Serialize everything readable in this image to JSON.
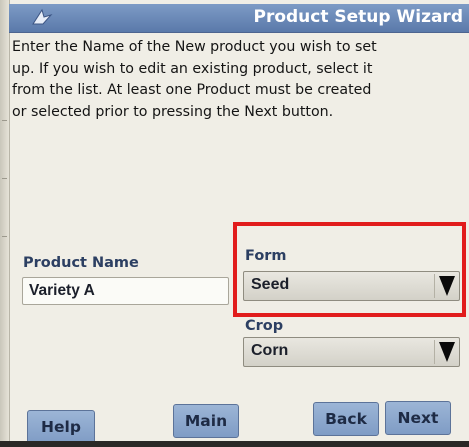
{
  "window": {
    "title": "Product Setup Wizard"
  },
  "instructions": {
    "lines": [
      "Enter the Name of the New product you wish to set",
      "up. If you wish to edit an existing product, select it",
      "from the list. At least one Product must be created",
      "or selected prior to pressing the Next button."
    ]
  },
  "product_name": {
    "label": "Product Name",
    "value": "Variety A"
  },
  "form": {
    "label": "Form",
    "selected": "Seed"
  },
  "crop": {
    "label": "Crop",
    "selected": "Corn"
  },
  "buttons": {
    "help": "Help",
    "main": "Main",
    "back": "Back",
    "next": "Next"
  },
  "icons": {
    "title": "wizard-arrow-icon",
    "dropdown": "dropdown-arrow-icon"
  },
  "colors": {
    "title_bar": "#6b89b8",
    "button": "#8ea8cd",
    "highlight": "#e11c1c",
    "background": "#f0eee6"
  }
}
